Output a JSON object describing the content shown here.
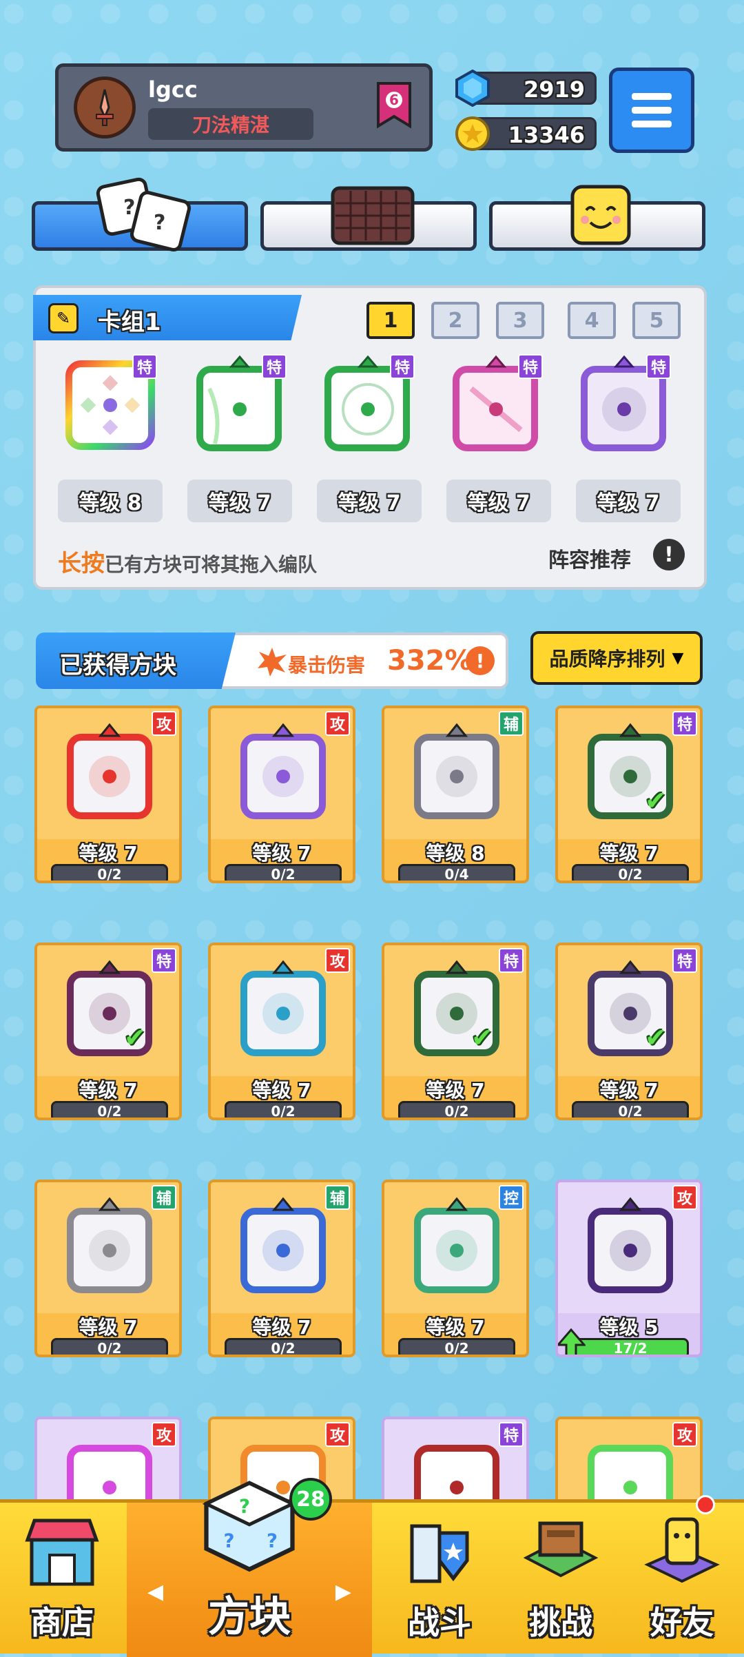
{
  "profile": {
    "name": "lgcc",
    "title": "刀法精湛",
    "rank": "6"
  },
  "currency": {
    "gems": "2919",
    "coins": "13346"
  },
  "deck": {
    "name": "卡组1",
    "numbers": [
      "1",
      "2",
      "3",
      "4",
      "5"
    ],
    "slots": [
      {
        "tag": "特",
        "level": "等级 8",
        "color": "#c86af0"
      },
      {
        "tag": "特",
        "level": "等级 7",
        "color": "#2faa4a"
      },
      {
        "tag": "特",
        "level": "等级 7",
        "color": "#2faa4a"
      },
      {
        "tag": "特",
        "level": "等级 7",
        "color": "#d04aa8"
      },
      {
        "tag": "特",
        "level": "等级 7",
        "color": "#8a5ad8"
      }
    ],
    "hint_key": "长按",
    "hint_text": "已有方块可将其拖入编队",
    "recommend": "阵容推荐",
    "recommend_icon": "!"
  },
  "owned": {
    "title": "已获得方块",
    "crit_label": "暴击伤害",
    "crit_value": "332%",
    "crit_icon": "!",
    "sort_label": "品质降序排列"
  },
  "cards": [
    {
      "tag": "攻",
      "level": "等级 7",
      "progress": "0/2",
      "color": "#e8342e",
      "checked": false
    },
    {
      "tag": "攻",
      "level": "等级 7",
      "progress": "0/2",
      "color": "#8a5ad8",
      "checked": false
    },
    {
      "tag": "辅",
      "level": "等级 8",
      "progress": "0/4",
      "color": "#7a7a88",
      "checked": false
    },
    {
      "tag": "特",
      "level": "等级 7",
      "progress": "0/2",
      "color": "#2f6a3a",
      "checked": true
    },
    {
      "tag": "特",
      "level": "等级 7",
      "progress": "0/2",
      "color": "#6a2a5a",
      "checked": true
    },
    {
      "tag": "攻",
      "level": "等级 7",
      "progress": "0/2",
      "color": "#2aa0c8",
      "checked": false
    },
    {
      "tag": "特",
      "level": "等级 7",
      "progress": "0/2",
      "color": "#2f6a3a",
      "checked": true
    },
    {
      "tag": "特",
      "level": "等级 7",
      "progress": "0/2",
      "color": "#4a3a6a",
      "checked": true
    },
    {
      "tag": "辅",
      "level": "等级 7",
      "progress": "0/2",
      "color": "#8a8a90",
      "checked": false
    },
    {
      "tag": "辅",
      "level": "等级 7",
      "progress": "0/2",
      "color": "#3a6ad8",
      "checked": false
    },
    {
      "tag": "控",
      "level": "等级 7",
      "progress": "0/2",
      "color": "#3aa87a",
      "checked": false
    },
    {
      "tag": "攻",
      "level": "等级 5",
      "progress": "17/2",
      "color": "#4a2a7a",
      "checked": false
    }
  ],
  "partial_cards": [
    {
      "tag": "攻",
      "color": "#d64ae0"
    },
    {
      "tag": "攻",
      "color": "#f08a2a"
    },
    {
      "tag": "特",
      "color": "#b02a2a"
    },
    {
      "tag": "攻",
      "color": "#5ad85a"
    }
  ],
  "nav": {
    "shop": "商店",
    "blocks": "方块",
    "battle": "战斗",
    "challenge": "挑战",
    "friends": "好友",
    "block_count": "28"
  },
  "icons": {
    "avatar": "sword-icon",
    "gem": "gem-icon",
    "coin": "coin-icon",
    "menu": "menu-icon"
  }
}
